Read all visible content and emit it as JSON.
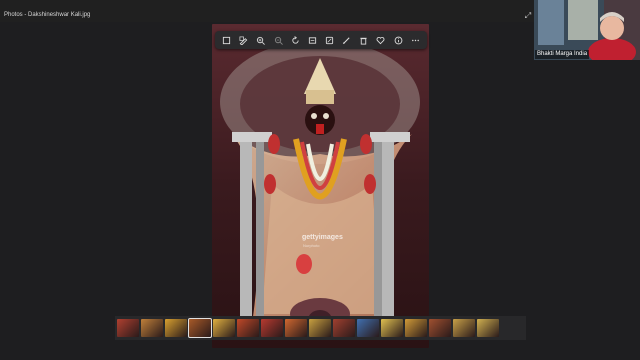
{
  "window": {
    "title": "Photos - Dakshineshwar Kali.jpg"
  },
  "toolbar": {
    "icons": [
      "crop-icon",
      "edit-icon",
      "zoom-in-icon",
      "zoom-out-icon",
      "rotate-icon",
      "fit-icon",
      "markup-icon",
      "draw-icon",
      "delete-icon",
      "favorite-icon",
      "info-icon",
      "more-icon"
    ]
  },
  "photo": {
    "watermark": "gettyimages",
    "watermark_credit": "Nurphoto"
  },
  "filmstrip": {
    "thumb_colors": [
      "#b04030",
      "#c0803a",
      "#d8a030",
      "#a85a28",
      "#e0b040",
      "#c04828",
      "#b83a30",
      "#d06830",
      "#c8a040",
      "#a04030",
      "#4070b0",
      "#e0c050",
      "#d09a38",
      "#a05030",
      "#c8a048",
      "#d0b050"
    ],
    "active_index": 3
  },
  "video": {
    "name": "Bhakti Marga India"
  },
  "colors": {
    "background": "#1e1e20",
    "toolbar": "#2b2b2d"
  }
}
